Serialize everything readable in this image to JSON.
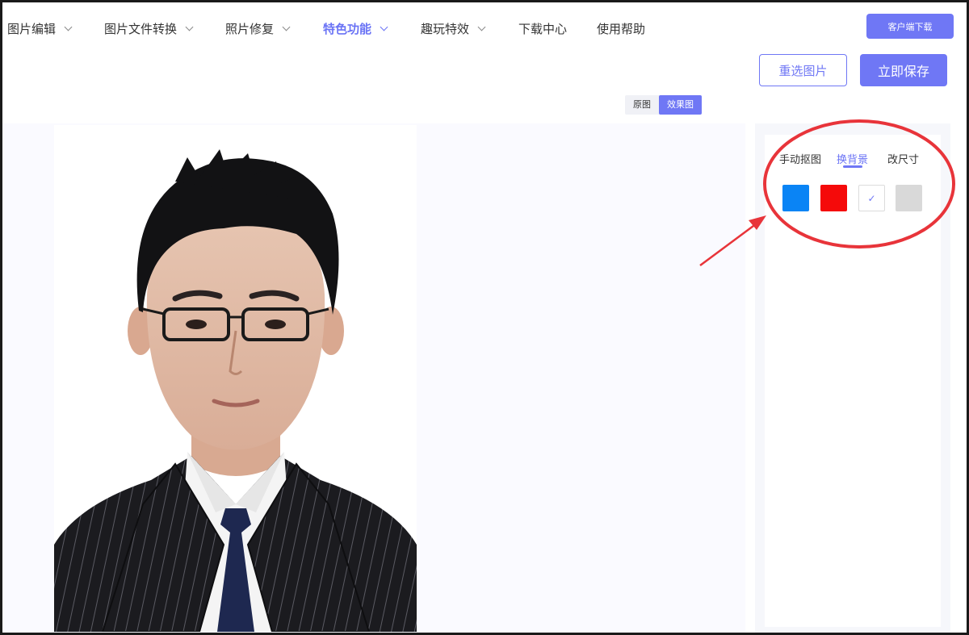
{
  "nav": {
    "items": [
      {
        "label": "图片编辑",
        "has_dropdown": true,
        "active": false
      },
      {
        "label": "图片文件转换",
        "has_dropdown": true,
        "active": false
      },
      {
        "label": "照片修复",
        "has_dropdown": true,
        "active": false
      },
      {
        "label": "特色功能",
        "has_dropdown": true,
        "active": true
      },
      {
        "label": "趣玩特效",
        "has_dropdown": true,
        "active": false
      },
      {
        "label": "下载中心",
        "has_dropdown": false,
        "active": false
      },
      {
        "label": "使用帮助",
        "has_dropdown": false,
        "active": false
      }
    ],
    "client_download": "客户端下载"
  },
  "actions": {
    "reselect": "重选图片",
    "save": "立即保存"
  },
  "view_toggle": {
    "original": "原图",
    "result": "效果图",
    "selected": "效果图"
  },
  "panel": {
    "tabs": [
      {
        "label": "手动抠图",
        "active": false
      },
      {
        "label": "换背景",
        "active": true
      },
      {
        "label": "改尺寸",
        "active": false
      }
    ],
    "swatches": [
      {
        "name": "blue",
        "color": "#0a84f5",
        "selected": false
      },
      {
        "name": "red",
        "color": "#f50a0a",
        "selected": false
      },
      {
        "name": "white",
        "color": "#ffffff",
        "selected": true
      },
      {
        "name": "light-gray",
        "color": "#d9d9d9",
        "selected": false
      }
    ],
    "check_glyph": "✓"
  },
  "colors": {
    "accent": "#6f77f5",
    "annotation_red": "#e8343a"
  }
}
